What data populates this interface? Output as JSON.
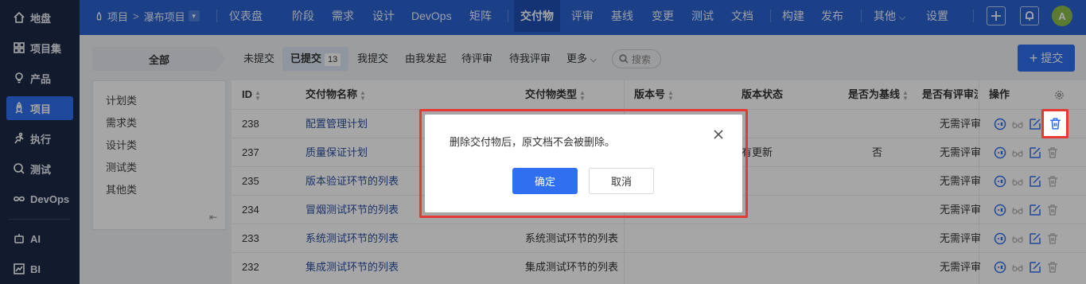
{
  "sidebar": {
    "items": [
      {
        "label": "地盘",
        "icon": "home-icon"
      },
      {
        "label": "项目集",
        "icon": "grid-icon"
      },
      {
        "label": "产品",
        "icon": "bulb-icon"
      },
      {
        "label": "项目",
        "icon": "rocket-icon",
        "active": true
      },
      {
        "label": "执行",
        "icon": "run-icon"
      },
      {
        "label": "测试",
        "icon": "test-icon"
      },
      {
        "label": "DevOps",
        "icon": "infinity-icon"
      },
      {
        "label": "AI",
        "icon": "robot-icon"
      },
      {
        "label": "BI",
        "icon": "chart-icon"
      }
    ]
  },
  "topbar": {
    "breadcrumb": {
      "root": "项目",
      "separator": ">",
      "current": "瀑布项目"
    },
    "nav": [
      "仪表盘",
      "阶段",
      "需求",
      "设计",
      "DevOps",
      "矩阵",
      "交付物",
      "评审",
      "基线",
      "变更",
      "测试",
      "文档",
      "构建",
      "发布",
      "其他",
      "设置"
    ],
    "active_nav": "交付物",
    "more_caret": "⌵",
    "avatar_letter": "A"
  },
  "filters": {
    "all_label": "全部",
    "tabs": [
      "未提交",
      "已提交",
      "我提交",
      "由我发起",
      "待评审",
      "待我评审",
      "更多"
    ],
    "active_tab": "已提交",
    "active_count": "13",
    "search_placeholder": "搜索",
    "submit_label": "提交"
  },
  "categories": [
    "计划类",
    "需求类",
    "设计类",
    "测试类",
    "其他类"
  ],
  "table": {
    "headers": {
      "id": "ID",
      "name": "交付物名称",
      "type": "交付物类型",
      "version": "版本号",
      "version_status": "版本状态",
      "is_baseline": "是否为基线",
      "has_review": "是否有评审流",
      "ops": "操作"
    },
    "rows": [
      {
        "id": "238",
        "name": "配置管理计划",
        "type": "",
        "version_status": "",
        "is_baseline": "",
        "review": "无需评审"
      },
      {
        "id": "237",
        "name": "质量保证计划",
        "type": "",
        "version_status": "有更新",
        "is_baseline": "否",
        "review": "无需评审"
      },
      {
        "id": "235",
        "name": "版本验证环节的列表",
        "type": "",
        "version_status": "",
        "is_baseline": "",
        "review": "无需评审"
      },
      {
        "id": "234",
        "name": "冒烟测试环节的列表",
        "type": "",
        "version_status": "",
        "is_baseline": "",
        "review": "无需评审"
      },
      {
        "id": "233",
        "name": "系统测试环节的列表",
        "type": "系统测试环节的列表",
        "version_status": "",
        "is_baseline": "",
        "review": "无需评审"
      },
      {
        "id": "232",
        "name": "集成测试环节的列表",
        "type": "集成测试环节的列表",
        "version_status": "",
        "is_baseline": "",
        "review": "无需评审"
      }
    ]
  },
  "dialog": {
    "message": "删除交付物后，原文档不会被删除。",
    "confirm": "确定",
    "cancel": "取消"
  },
  "colors": {
    "primary": "#2f6ff0",
    "topbar": "#2c63cf",
    "sidebar": "#1d2a47",
    "highlight": "#e53935"
  }
}
